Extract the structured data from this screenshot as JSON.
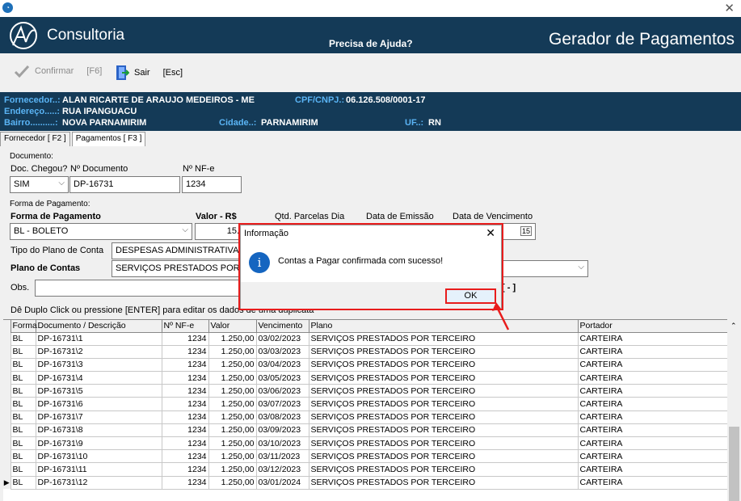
{
  "header": {
    "brand": "Consultoria",
    "help": "Precisa de Ajuda?",
    "title": "Gerador de Pagamentos"
  },
  "toolbar": {
    "confirm_label": "Confirmar",
    "confirm_key": "[F6]",
    "exit_label": "Sair",
    "exit_key": "[Esc]"
  },
  "supplier": {
    "fornecedor_label": "Fornecedor..:",
    "fornecedor": "ALAN RICARTE DE ARAUJO MEDEIROS - ME",
    "cpf_label": "CPF/CNPJ.:",
    "cpf": "06.126.508/0001-17",
    "endereco_label": "Endereço.....:",
    "endereco": "RUA IPANGUACU",
    "bairro_label": "Bairro..........:",
    "bairro": "NOVA PARNAMIRIM",
    "cidade_label": "Cidade..:",
    "cidade": "PARNAMIRIM",
    "uf_label": "UF..:",
    "uf": "RN"
  },
  "tabs": [
    "Fornecedor [ F2 ]",
    "Pagamentos [ F3 ]"
  ],
  "documento": {
    "section": "Documento:",
    "doc_chegou_label": "Doc. Chegou?",
    "doc_chegou": "SIM",
    "num_doc_label": "Nº Documento",
    "num_doc": "DP-16731",
    "nf_label": "Nº NF-e",
    "nf": "1234"
  },
  "pagamento": {
    "section": "Forma de Pagamento:",
    "forma_label": "Forma de Pagamento",
    "forma": "BL - BOLETO",
    "valor_label": "Valor - R$",
    "valor": "15.",
    "qtd_label": "Qtd. Parcelas Dia",
    "emissao_label": "Data de Emissão",
    "vencimento_label": "Data de Vencimento",
    "tipo_plano_label": "Tipo do Plano de Conta",
    "tipo_plano": "DESPESAS ADMINISTRATIVAS",
    "plano_label": "Plano de Contas",
    "plano": "SERVIÇOS PRESTADOS POR T",
    "obs_label": "Obs.",
    "minus_btn": "[ - ]",
    "hint": "Dê Duplo Click ou pressione [ENTER] para editar os dados de uma duplicata"
  },
  "grid": {
    "columns": [
      "Forma",
      "Documento / Descrição",
      "Nº NF-e",
      "Valor",
      "Vencimento",
      "Plano",
      "Portador"
    ],
    "rows": [
      [
        "BL",
        "DP-16731\\1",
        "1234",
        "1.250,00",
        "03/02/2023",
        "SERVIÇOS PRESTADOS POR TERCEIRO",
        "CARTEIRA"
      ],
      [
        "BL",
        "DP-16731\\2",
        "1234",
        "1.250,00",
        "03/03/2023",
        "SERVIÇOS PRESTADOS POR TERCEIRO",
        "CARTEIRA"
      ],
      [
        "BL",
        "DP-16731\\3",
        "1234",
        "1.250,00",
        "03/04/2023",
        "SERVIÇOS PRESTADOS POR TERCEIRO",
        "CARTEIRA"
      ],
      [
        "BL",
        "DP-16731\\4",
        "1234",
        "1.250,00",
        "03/05/2023",
        "SERVIÇOS PRESTADOS POR TERCEIRO",
        "CARTEIRA"
      ],
      [
        "BL",
        "DP-16731\\5",
        "1234",
        "1.250,00",
        "03/06/2023",
        "SERVIÇOS PRESTADOS POR TERCEIRO",
        "CARTEIRA"
      ],
      [
        "BL",
        "DP-16731\\6",
        "1234",
        "1.250,00",
        "03/07/2023",
        "SERVIÇOS PRESTADOS POR TERCEIRO",
        "CARTEIRA"
      ],
      [
        "BL",
        "DP-16731\\7",
        "1234",
        "1.250,00",
        "03/08/2023",
        "SERVIÇOS PRESTADOS POR TERCEIRO",
        "CARTEIRA"
      ],
      [
        "BL",
        "DP-16731\\8",
        "1234",
        "1.250,00",
        "03/09/2023",
        "SERVIÇOS PRESTADOS POR TERCEIRO",
        "CARTEIRA"
      ],
      [
        "BL",
        "DP-16731\\9",
        "1234",
        "1.250,00",
        "03/10/2023",
        "SERVIÇOS PRESTADOS POR TERCEIRO",
        "CARTEIRA"
      ],
      [
        "BL",
        "DP-16731\\10",
        "1234",
        "1.250,00",
        "03/11/2023",
        "SERVIÇOS PRESTADOS POR TERCEIRO",
        "CARTEIRA"
      ],
      [
        "BL",
        "DP-16731\\11",
        "1234",
        "1.250,00",
        "03/12/2023",
        "SERVIÇOS PRESTADOS POR TERCEIRO",
        "CARTEIRA"
      ],
      [
        "BL",
        "DP-16731\\12",
        "1234",
        "1.250,00",
        "03/01/2024",
        "SERVIÇOS PRESTADOS POR TERCEIRO",
        "CARTEIRA"
      ]
    ]
  },
  "dialog": {
    "title": "Informação",
    "message": "Contas a Pagar confirmada com sucesso!",
    "ok": "OK"
  },
  "colors": {
    "header_bg": "#143a57",
    "label_blue": "#5ab4f5",
    "highlight_red": "#e81c1c"
  }
}
